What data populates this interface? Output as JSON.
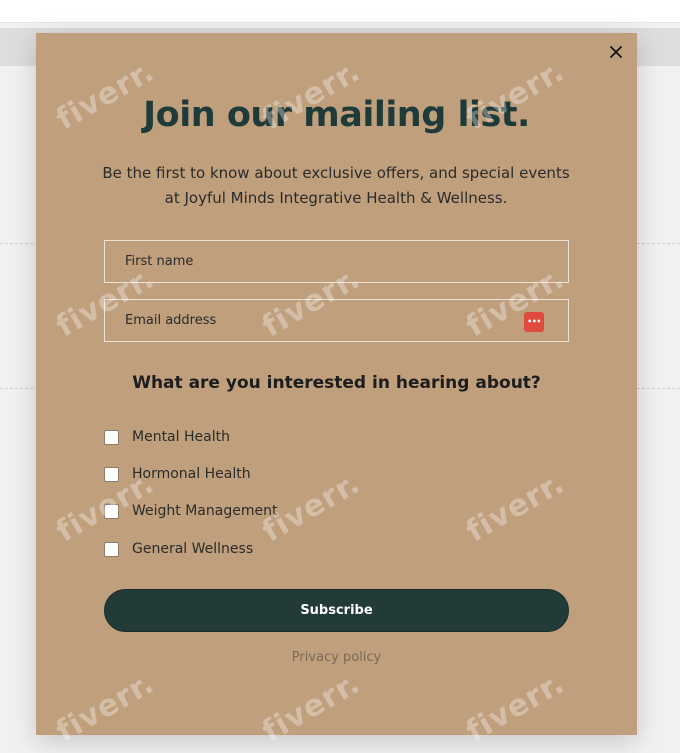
{
  "popup": {
    "title": "Join our mailing list.",
    "subtitle": "Be the first to know about exclusive offers, and special events at Joyful Minds Integrative Health & Wellness.",
    "fields": {
      "first_name_placeholder": "First name",
      "email_placeholder": "Email address"
    },
    "question": "What are you interested in hearing about?",
    "options": [
      {
        "label": "Mental Health",
        "checked": false
      },
      {
        "label": "Hormonal Health",
        "checked": false
      },
      {
        "label": "Weight Management",
        "checked": false
      },
      {
        "label": "General Wellness",
        "checked": false
      }
    ],
    "subscribe_label": "Subscribe",
    "privacy_label": "Privacy policy",
    "close_icon": "close-icon",
    "password_manager_badge": "•••"
  },
  "watermark": {
    "text": "fiverr."
  },
  "colors": {
    "modal_bg": "#bf9f7c",
    "title": "#1e3a39",
    "button_bg": "#223a38",
    "badge": "#e0493d"
  }
}
